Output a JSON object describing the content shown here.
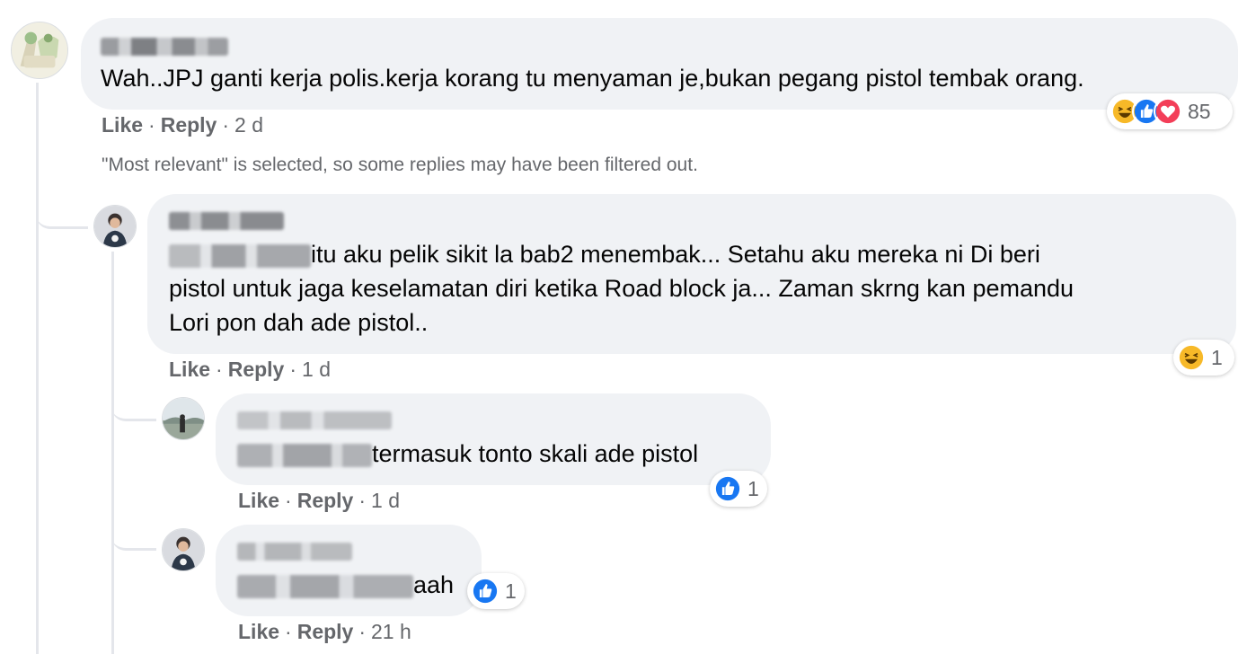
{
  "comments": [
    {
      "author": "",
      "text": "Wah..JPJ ganti kerja polis.kerja korang tu menyaman je,bukan pegang pistol tembak orang.",
      "actions": {
        "like": "Like",
        "reply": "Reply",
        "time": "2 d"
      },
      "reactions": {
        "icons": [
          "haha-icon",
          "like-icon",
          "love-icon"
        ],
        "count": "85"
      }
    },
    {
      "author": "",
      "mention": "",
      "text_line1": "itu aku pelik sikit la bab2 menembak... Setahu aku mereka ni Di beri",
      "text_line2": "pistol untuk jaga keselamatan diri ketika Road block ja... Zaman skrng kan pemandu",
      "text_line3": "Lori pon dah ade pistol..",
      "actions": {
        "like": "Like",
        "reply": "Reply",
        "time": "1 d"
      },
      "reactions": {
        "icons": [
          "haha-icon"
        ],
        "count": "1"
      }
    },
    {
      "author": "",
      "mention": "",
      "text": "termasuk tonto skali ade pistol",
      "actions": {
        "like": "Like",
        "reply": "Reply",
        "time": "1 d"
      },
      "reactions": {
        "icons": [
          "like-icon"
        ],
        "count": "1"
      }
    },
    {
      "author": "",
      "mention": "",
      "text": "aah",
      "actions": {
        "like": "Like",
        "reply": "Reply",
        "time": "21 h"
      },
      "reactions": {
        "icons": [
          "like-icon"
        ],
        "count": "1"
      }
    }
  ],
  "filter_notice": "\"Most relevant\" is selected, so some replies may have been filtered out.",
  "colors": {
    "bubble": "#f0f2f5",
    "secondary_text": "#65676b",
    "like_blue": "#1877f2",
    "love_red": "#f33e58",
    "haha_yellow": "#f7b928"
  }
}
